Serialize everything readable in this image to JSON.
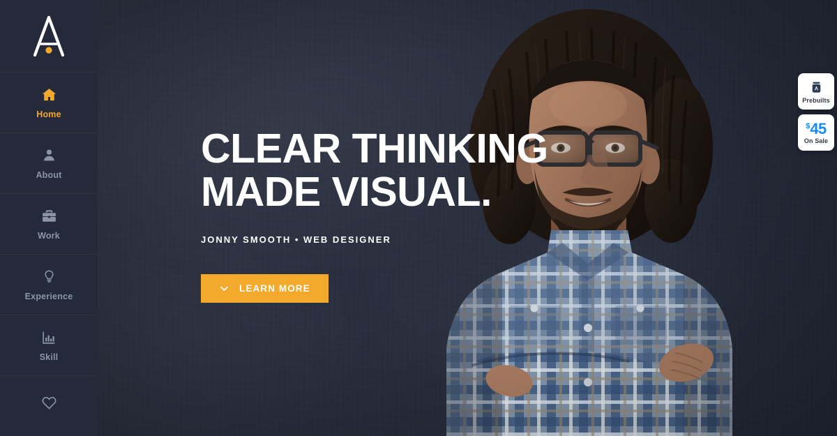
{
  "brand": {
    "logo_letter": "A",
    "logo_icon": "letter-a-with-dot-logo",
    "accent_color": "#f2a92c",
    "sidebar_color": "#242a39"
  },
  "sidebar": {
    "items": [
      {
        "label": "Home",
        "icon": "home-icon",
        "active": true
      },
      {
        "label": "About",
        "icon": "person-icon",
        "active": false
      },
      {
        "label": "Work",
        "icon": "briefcase-icon",
        "active": false
      },
      {
        "label": "Experience",
        "icon": "lightbulb-icon",
        "active": false
      },
      {
        "label": "Skill",
        "icon": "bar-chart-icon",
        "active": false
      },
      {
        "label": "",
        "icon": "heart-icon",
        "active": false
      }
    ]
  },
  "hero": {
    "headline_line1": "CLEAR THINKING",
    "headline_line2": "MADE VISUAL.",
    "subtitle": "JONNY SMOOTH • WEB DESIGNER",
    "cta_label": "LEARN MORE",
    "cta_icon": "chevron-down-icon",
    "cta_color": "#f2a92c"
  },
  "portrait": {
    "alt": "smiling-man-with-dreadlocks-glasses-plaid-shirt"
  },
  "widget": {
    "prebuilts": {
      "label": "Prebuilts",
      "icon": "prebuilts-jar-icon"
    },
    "sale": {
      "currency": "$",
      "amount": "45",
      "label": "On Sale",
      "color": "#1a8cf0"
    }
  }
}
